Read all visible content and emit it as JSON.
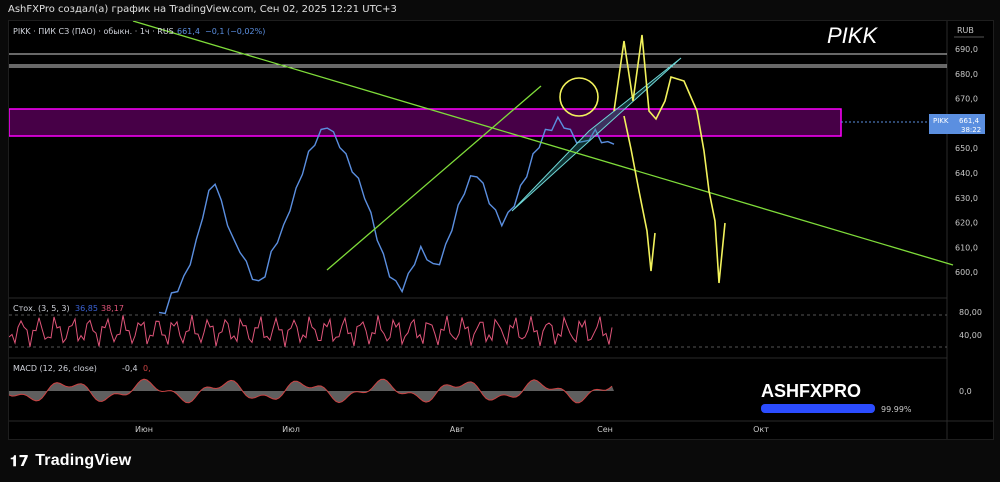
{
  "caption": "AshFXPro создал(а) график на TradingView.com, Сен 02, 2025 12:21 UTC+3",
  "symbol_header": {
    "name": "PIKK · ПИК СЗ (ПАО) · обыкн. · 1ч · RUS",
    "price": "661,4",
    "change": "−0,1 (−0,02%)"
  },
  "ticker_label": "PIKK",
  "currency": "RUB",
  "price_tag": {
    "symbol": "PIKK",
    "price": "661,4",
    "countdown": "38:22"
  },
  "brand": {
    "name": "ASHFXPRO",
    "progress_label": "99.99%",
    "progress": 0.9999
  },
  "footer_logo": "TradingView",
  "colors": {
    "price_line": "#5b8fe0",
    "zone": "#ff00ff",
    "trend": "#7fdc3a",
    "forecast": "#f2f25c",
    "stoch_k": "#3b63d6",
    "stoch_d": "#e0557a",
    "macd": "#c44",
    "macd_hist": "#bdbdbd"
  },
  "chart_data": {
    "type": "line",
    "title": "",
    "x_labels": [
      "Июн",
      "Июл",
      "Авг",
      "Сен",
      "Окт"
    ],
    "y_ticks": [
      "690,0",
      "680,0",
      "670,0",
      "660,0",
      "650,0",
      "640,0",
      "630,0",
      "620,0",
      "610,0",
      "600,0"
    ],
    "ylim": [
      595,
      695
    ],
    "series": [
      {
        "values": [
          590,
          592,
          598,
          601,
          605,
          612,
          620,
          631,
          640,
          645,
          636,
          628,
          620,
          617,
          611,
          606,
          603,
          607,
          615,
          621,
          626,
          634,
          641,
          649,
          656,
          661,
          665,
          668,
          664,
          660,
          655,
          650,
          645,
          639,
          631,
          622,
          614,
          607,
          603,
          601,
          606,
          612,
          617,
          614,
          610,
          612,
          618,
          626,
          634,
          641,
          646,
          648,
          643,
          637,
          632,
          628,
          631,
          636,
          642,
          648,
          655,
          660,
          665,
          667,
          670,
          668,
          665,
          662,
          660,
          663,
          665,
          662,
          660,
          661.4
        ]
      }
    ],
    "zone": {
      "low": 655.5,
      "high": 667
    },
    "forecast_paths": [
      [
        [
          0.0,
          661
        ],
        [
          0.05,
          690
        ],
        [
          0.1,
          650
        ],
        [
          0.16,
          603
        ]
      ],
      [
        [
          0.2,
          665
        ],
        [
          0.25,
          675
        ],
        [
          0.3,
          640
        ],
        [
          0.36,
          598
        ],
        [
          0.4,
          618
        ]
      ]
    ],
    "stoch": {
      "label": "Стох. (3, 5, 3)",
      "k": "36,85",
      "d": "38,17",
      "levels": [
        "80,00",
        "40,00"
      ]
    },
    "macd": {
      "label": "MACD (12, 26, close)",
      "macd": "-0,4",
      "signal": "0,",
      "axis": "0,0"
    }
  }
}
